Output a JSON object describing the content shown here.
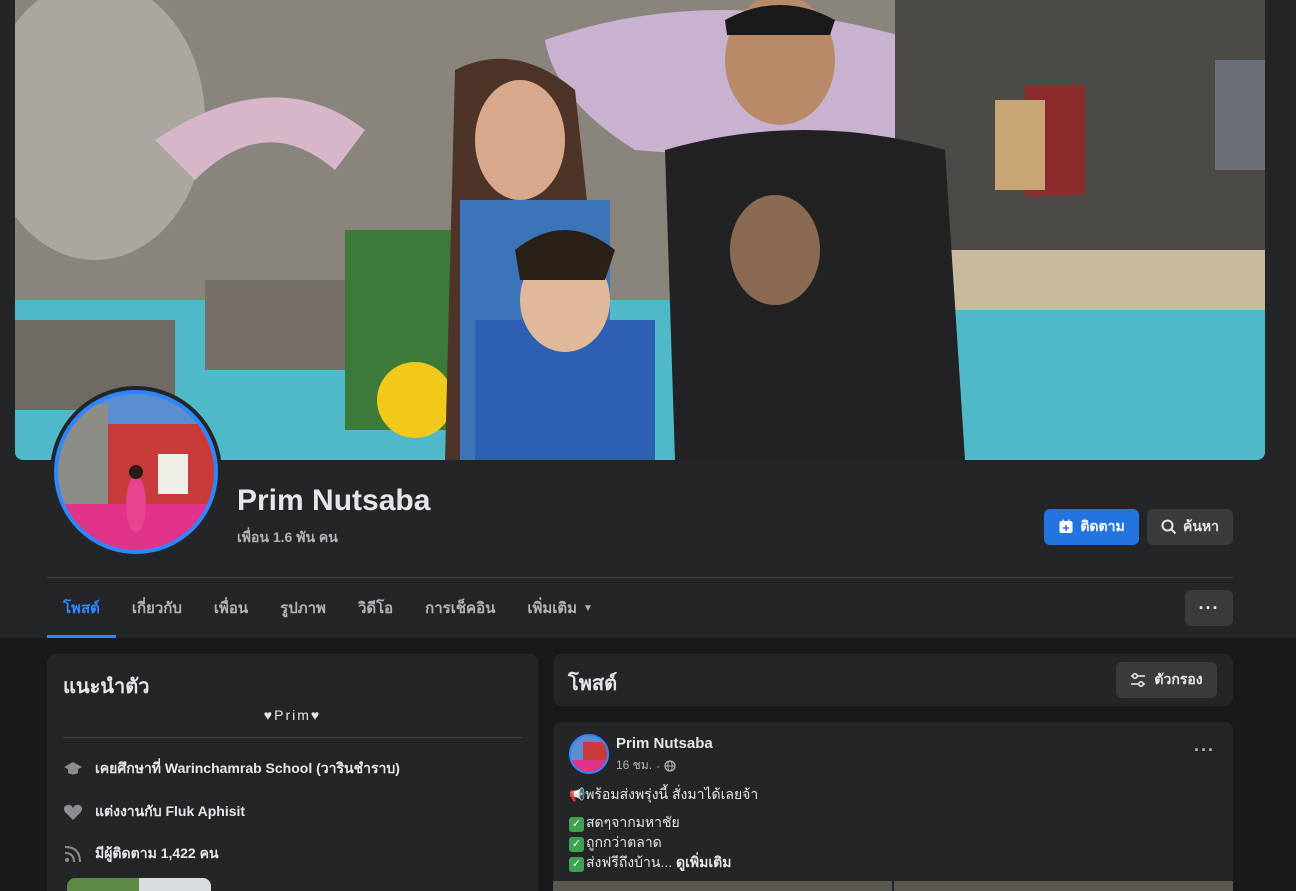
{
  "profile": {
    "name": "Prim Nutsaba",
    "friends": "เพื่อน 1.6 พัน คน"
  },
  "actions": {
    "follow_label": "ติดตาม",
    "search_label": "ค้นหา"
  },
  "tabs": [
    {
      "label": "โพสต์",
      "active": true
    },
    {
      "label": "เกี่ยวกับ"
    },
    {
      "label": "เพื่อน"
    },
    {
      "label": "รูปภาพ"
    },
    {
      "label": "วิดีโอ"
    },
    {
      "label": "การเช็คอิน"
    },
    {
      "label": "เพิ่มเติม"
    }
  ],
  "intro": {
    "title": "แนะนำตัว",
    "bio": "♥Prim♥",
    "education": "เคยศึกษาที่ Warinchamrab School (วารินชำราบ)",
    "relationship": "แต่งงานกับ Fluk Aphisit",
    "followers_prefix": "มีผู้ติดตาม ",
    "followers_count": "1,422",
    "followers_suffix": " คน"
  },
  "posts_section": {
    "title": "โพสต์",
    "filter_label": "ตัวกรอง"
  },
  "post": {
    "author": "Prim Nutsaba",
    "time": "16 ชม.",
    "line1": "พร้อมส่งพรุ่งนี้   สั่งมาได้เลยจ้า",
    "line2": "สดๆจากมหาชัย",
    "line3": "ถูกกว่าตลาด",
    "line4": "ส่งฟรีถึงบ้าน... ",
    "see_more": "ดูเพิ่มเติม"
  },
  "colors": {
    "accent": "#2d88ff",
    "button_primary": "#2374e1",
    "surface": "#242526",
    "background": "#18191a"
  }
}
